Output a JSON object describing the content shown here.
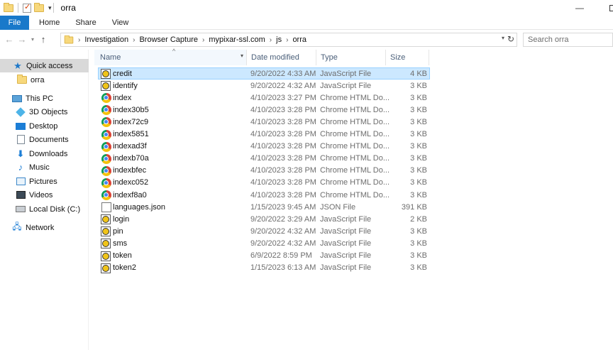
{
  "window": {
    "title": "orra"
  },
  "ribbon": {
    "tabs": [
      "File",
      "Home",
      "Share",
      "View"
    ]
  },
  "address": {
    "crumbs": [
      "Investigation",
      "Browser Capture",
      "mypixar-ssl.com",
      "js",
      "orra"
    ]
  },
  "search": {
    "placeholder": "Search orra"
  },
  "sidebar": {
    "items": [
      {
        "label": "Quick access",
        "icon": "star-icon"
      },
      {
        "label": "orra",
        "icon": "folder-icon"
      },
      {
        "label": "This PC",
        "icon": "computer-icon"
      },
      {
        "label": "3D Objects",
        "icon": "cube-icon"
      },
      {
        "label": "Desktop",
        "icon": "desktop-icon"
      },
      {
        "label": "Documents",
        "icon": "documents-icon"
      },
      {
        "label": "Downloads",
        "icon": "download-icon"
      },
      {
        "label": "Music",
        "icon": "music-icon"
      },
      {
        "label": "Pictures",
        "icon": "pictures-icon"
      },
      {
        "label": "Videos",
        "icon": "videos-icon"
      },
      {
        "label": "Local Disk (C:)",
        "icon": "disk-icon"
      },
      {
        "label": "Network",
        "icon": "network-icon"
      }
    ]
  },
  "columns": {
    "name": "Name",
    "date": "Date modified",
    "type": "Type",
    "size": "Size"
  },
  "files": [
    {
      "name": "credit",
      "date": "9/20/2022 4:33 AM",
      "type": "JavaScript File",
      "size": "4 KB",
      "icon": "js"
    },
    {
      "name": "identify",
      "date": "9/20/2022 4:32 AM",
      "type": "JavaScript File",
      "size": "3 KB",
      "icon": "js"
    },
    {
      "name": "index",
      "date": "4/10/2023 3:27 PM",
      "type": "Chrome HTML Do...",
      "size": "3 KB",
      "icon": "chrome"
    },
    {
      "name": "index30b5",
      "date": "4/10/2023 3:28 PM",
      "type": "Chrome HTML Do...",
      "size": "3 KB",
      "icon": "chrome"
    },
    {
      "name": "index72c9",
      "date": "4/10/2023 3:28 PM",
      "type": "Chrome HTML Do...",
      "size": "3 KB",
      "icon": "chrome"
    },
    {
      "name": "index5851",
      "date": "4/10/2023 3:28 PM",
      "type": "Chrome HTML Do...",
      "size": "3 KB",
      "icon": "chrome"
    },
    {
      "name": "indexad3f",
      "date": "4/10/2023 3:28 PM",
      "type": "Chrome HTML Do...",
      "size": "3 KB",
      "icon": "chrome"
    },
    {
      "name": "indexb70a",
      "date": "4/10/2023 3:28 PM",
      "type": "Chrome HTML Do...",
      "size": "3 KB",
      "icon": "chrome"
    },
    {
      "name": "indexbfec",
      "date": "4/10/2023 3:28 PM",
      "type": "Chrome HTML Do...",
      "size": "3 KB",
      "icon": "chrome"
    },
    {
      "name": "indexc052",
      "date": "4/10/2023 3:28 PM",
      "type": "Chrome HTML Do...",
      "size": "3 KB",
      "icon": "chrome"
    },
    {
      "name": "indexf8a0",
      "date": "4/10/2023 3:28 PM",
      "type": "Chrome HTML Do...",
      "size": "3 KB",
      "icon": "chrome"
    },
    {
      "name": "languages.json",
      "date": "1/15/2023 9:45 AM",
      "type": "JSON File",
      "size": "391 KB",
      "icon": "json"
    },
    {
      "name": "login",
      "date": "9/20/2022 3:29 AM",
      "type": "JavaScript File",
      "size": "2 KB",
      "icon": "js"
    },
    {
      "name": "pin",
      "date": "9/20/2022 4:32 AM",
      "type": "JavaScript File",
      "size": "3 KB",
      "icon": "js"
    },
    {
      "name": "sms",
      "date": "9/20/2022 4:32 AM",
      "type": "JavaScript File",
      "size": "3 KB",
      "icon": "js"
    },
    {
      "name": "token",
      "date": "6/9/2022 8:59 PM",
      "type": "JavaScript File",
      "size": "3 KB",
      "icon": "js"
    },
    {
      "name": "token2",
      "date": "1/15/2023 6:13 AM",
      "type": "JavaScript File",
      "size": "3 KB",
      "icon": "js"
    }
  ],
  "colors": {
    "accent": "#1979ca",
    "selection": "#cce8ff",
    "selection_border": "#99d1ff"
  }
}
